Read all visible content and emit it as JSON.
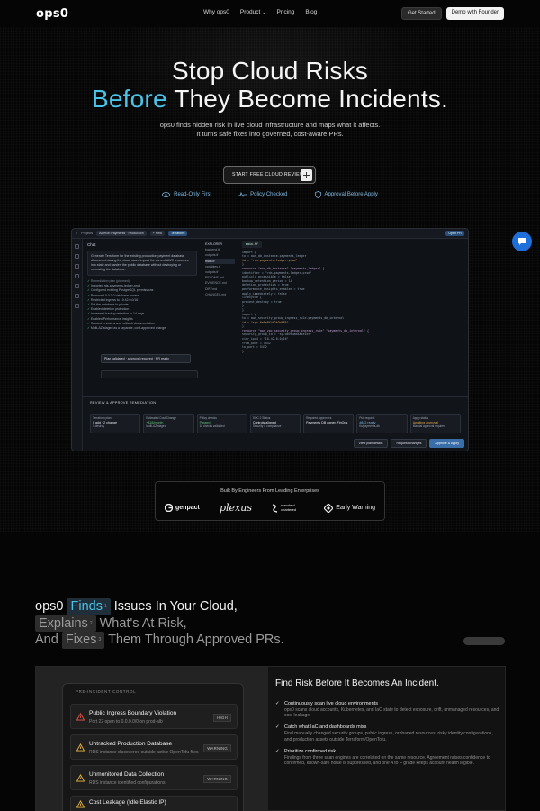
{
  "nav": {
    "logo": "ops0",
    "links": [
      "Why ops0",
      "Product",
      "Pricing",
      "Blog"
    ],
    "get_started": "Get Started",
    "demo": "Demo with Founder"
  },
  "hero": {
    "line1": "Stop Cloud Risks",
    "accent": "Before",
    "line2_rest": "They Become Incidents.",
    "sub1": "ops0 finds hidden risk in live cloud infrastructure and maps what it affects.",
    "sub2": "It turns safe fixes into governed, cost-aware PRs.",
    "cta": "START FREE CLOUD REVIEW",
    "features": [
      "Read-Only First",
      "Policy Checked",
      "Approval Before Apply"
    ]
  },
  "app": {
    "breadcrumb": [
      "Projects",
      "Acleron Payments · Production"
    ],
    "new_btn": "+ New",
    "terraform": "Terraform",
    "open_pr": "Open PR",
    "chat_title": "Chat",
    "chat_msg": "Generate Terraform for the existing production payment database discovered during the cloud scan. Import the current AWS resources into state and harden the public database without destroying or recreating the database.",
    "plan_title": "Remediation plan (planned)",
    "plan": [
      "Imported rds-payments-ledger-prod",
      "Configured existing PostgreSQL permissions",
      "Removed 0.0.0.0 database access",
      "Restricted ingress to 10.42.0.0/16",
      "Set the database to private",
      "Enabled deletion protection",
      "Increased backup retention to 14 days",
      "Enabled Performance Insights",
      "Created revisions and rollback documentation",
      "Multi-AZ staged as a separate, cost-approved change"
    ],
    "validated": "Plan validated · approval required · PR ready",
    "explorer_label": "EXPLORER",
    "files": [
      "backend.tf",
      "outputs.tf",
      "main.tf",
      "variables.tf",
      "outputs.tf",
      "README.md",
      "EVIDENCE.md",
      "DIFF.md",
      "CHANGES.md"
    ],
    "editor_tab": "main.tf",
    "code": [
      "import {",
      "  to = aws_db_instance.payments_ledger",
      "  id = \"rds-payments-ledger-prod\"",
      "}",
      "resource \"aws_db_instance\" \"payments_ledger\" {",
      "  identifier = \"rds-payments-ledger-prod\"",
      "  publicly_accessible = false",
      "  backup_retention_period = 14",
      "  deletion_protection = true",
      "  performance_insights_enabled = true",
      "  apply_immediately = false",
      "  lifecycle {",
      "    prevent_destroy = true",
      "  }",
      "}",
      "import {",
      "  to = aws_security_group_ingress_rule.payments_db_internal",
      "  id = \"sgr-0e9a8f4f2b3d485\"",
      "}",
      "resource \"aws_vpc_security_group_ingress_rule\" \"payments_db_internal\" {",
      "  security_group_id = \"sg-0b9f3a84a4e1ef\"",
      "  cidr_ipv4 = \"10.42.0.0/16\"",
      "  from_port = 5432",
      "  to_port = 5432",
      "}"
    ],
    "review_title": "REVIEW & APPROVE REMEDIATION",
    "cards": [
      {
        "k": "Terraform plan",
        "v": "0 add · 2 change",
        "s": "0 destroy"
      },
      {
        "k": "Estimated Cost Change",
        "v": "+$18/month",
        "s": "Multi-AZ staged"
      },
      {
        "k": "Policy checks",
        "v": "Passed",
        "s": "18 checks validated"
      },
      {
        "k": "SOC 2 Status",
        "v": "Controls aligned",
        "s": "Security & compliance"
      },
      {
        "k": "Required Approvers",
        "v": "Payments DB owner, FinOps",
        "s": ""
      },
      {
        "k": "Pull request",
        "v": "#842 ready",
        "s": "fix/payments-db"
      },
      {
        "k": "Apply status",
        "v": "Awaiting approval",
        "s": "Manual approval required"
      }
    ],
    "actions": [
      "View plan details",
      "Request changes",
      "Approve & Apply"
    ]
  },
  "trust": {
    "label": "Built By Engineers From Leading Enterprises",
    "logos": [
      "genpact",
      "plexus",
      "standard chartered",
      "Early Warning"
    ]
  },
  "section2": {
    "brand": "ops0",
    "finds": "Finds",
    "finds_rest": "Issues In Your Cloud,",
    "explains": "Explains",
    "explains_rest": "What's At Risk,",
    "and": "And",
    "fixes": "Fixes",
    "fixes_rest": "Them Through Approved PRs.",
    "marks": [
      "1",
      "2",
      "3"
    ]
  },
  "control": {
    "header": "PRE-INCIDENT CONTROL",
    "issues": [
      {
        "title": "Public Ingress Boundary Violation",
        "desc": "Port 22 open to 0.0.0.0/0 on prod-alb",
        "badge": "HIGH"
      },
      {
        "title": "Untracked Production Database",
        "desc": "RDS instance discovered outside active OpenTofu files",
        "badge": "WARNING"
      },
      {
        "title": "Unmonitored Data Collection",
        "desc": "RDS instance identified configurations",
        "badge": "WARNING"
      },
      {
        "title": "Cost Leakage (Idle Elastic IP)",
        "desc": "",
        "badge": ""
      }
    ]
  },
  "right": {
    "title": "Find Risk Before It Becomes An Incident.",
    "items": [
      {
        "h": "Continuously scan live cloud environments",
        "p": "ops0 scans cloud accounts, Kubernetes, and IaC state to detect exposure, drift, unmanaged resources, and cost leakage."
      },
      {
        "h": "Catch what IaC and dashboards miss",
        "p": "Find manually changed security groups, public ingress, orphaned resources, risky identity configurations, and production assets outside Terraform/OpenTofu."
      },
      {
        "h": "Prioritize confirmed risk",
        "p": "Findings from three scan engines are correlated on the same resource. Agreement raises confidence to confirmed, known-safe noise is suppressed, and one A to F grade keeps account health legible."
      }
    ]
  },
  "colors": {
    "accent": "#4ac3e8",
    "warning": "#e3b341",
    "danger": "#e5534b",
    "approve": "#3a6ea8",
    "chat_bubble": "#1e6fd9"
  }
}
